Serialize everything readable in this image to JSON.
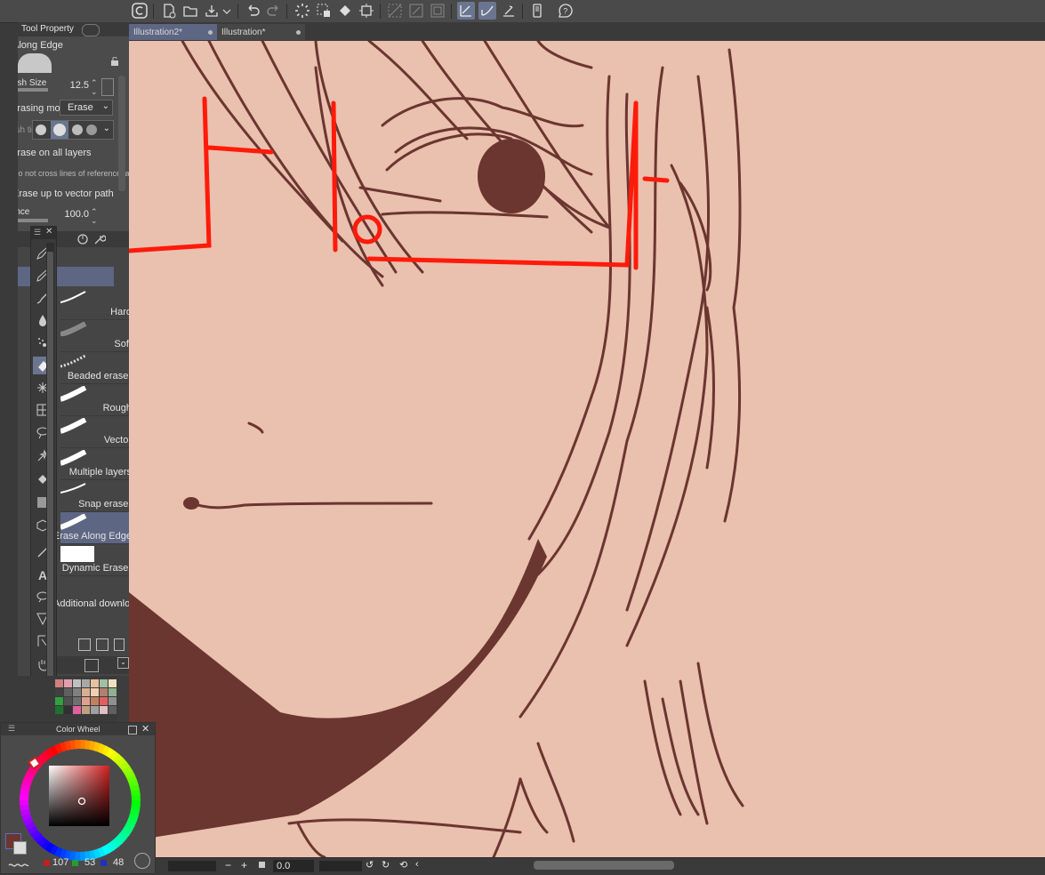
{
  "tabs": [
    {
      "label": "Illustration2*",
      "active": true
    },
    {
      "label": "Illustration*",
      "active": false
    }
  ],
  "tool_property": {
    "tab_label": "Tool Property",
    "subtool_name": "Along Edge",
    "brush_size_label": "Brush Size",
    "brush_size_value": "12.5",
    "erasing_mode_label": "Erasing mode",
    "erasing_mode_value": "Erase",
    "eraser_shape_label": "Brush tip shape",
    "erase_all_layers": "Erase on all layers",
    "not_cross_lines": "Do not cross lines of reference layer",
    "up_to_vector": "Erase up to vector path",
    "tolerance_label": "Tolerance",
    "tolerance_value": "100.0"
  },
  "subtools": [
    {
      "label": "Hard",
      "selected": false
    },
    {
      "label": "Soft",
      "selected": false
    },
    {
      "label": "Beaded eraser",
      "selected": false
    },
    {
      "label": "Rough",
      "selected": false
    },
    {
      "label": "Vector",
      "selected": false
    },
    {
      "label": "Multiple layers",
      "selected": false
    },
    {
      "label": "Snap eraser",
      "selected": false
    },
    {
      "label": "Erase Along Edge",
      "selected": true
    },
    {
      "label": "Dynamic Eraser",
      "selected": false
    }
  ],
  "subtool_footer": "Additional downloads",
  "color_wheel": {
    "title": "Color Wheel",
    "r": "107",
    "g": "53",
    "b": "48",
    "main_color": "#6b3530"
  },
  "status": {
    "zoom": "0.0"
  },
  "colors": {
    "canvas_bg": "#eac0ae",
    "line": "#6b3530",
    "glasses": "#ff1a0a",
    "accent": "#6a7590"
  }
}
